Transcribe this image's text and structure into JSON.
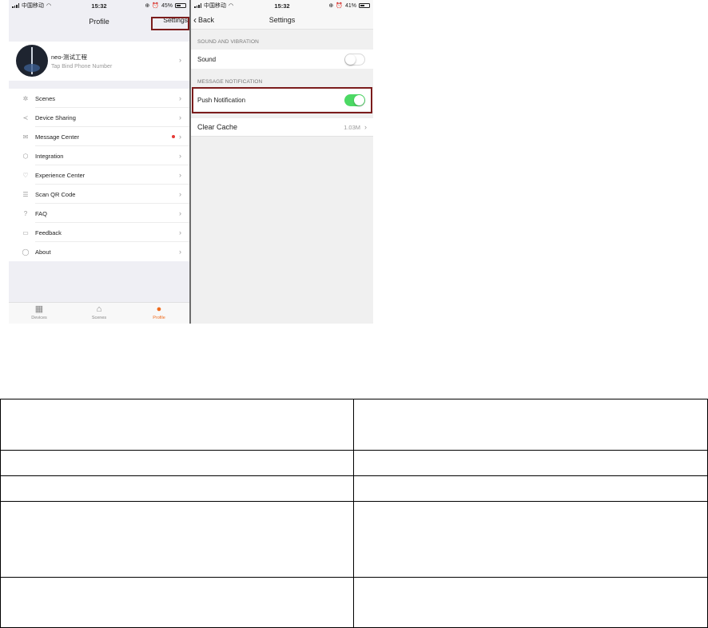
{
  "colors": {
    "accent": "#ef6c1e",
    "toggle_on": "#4cd964",
    "highlight": "#7b1c1c",
    "badge": "#e53935"
  },
  "left_screen": {
    "status": {
      "carrier": "中国移动",
      "time": "15:32",
      "battery": "45%"
    },
    "nav": {
      "title": "Profile",
      "right_action": "Settings"
    },
    "profile": {
      "name": "neo-测试工程",
      "subtitle": "Tap Bind Phone Number"
    },
    "menu": [
      {
        "label": "Scenes",
        "icon": "scenes-icon"
      },
      {
        "label": "Device Sharing",
        "icon": "share-icon"
      },
      {
        "label": "Message Center",
        "icon": "mail-icon",
        "badge": true
      },
      {
        "label": "Integration",
        "icon": "integration-icon"
      },
      {
        "label": "Experience Center",
        "icon": "heart-icon"
      },
      {
        "label": "Scan QR Code",
        "icon": "scan-icon"
      },
      {
        "label": "FAQ",
        "icon": "question-icon"
      },
      {
        "label": "Feedback",
        "icon": "feedback-icon"
      },
      {
        "label": "About",
        "icon": "about-icon"
      }
    ],
    "tabs": [
      {
        "label": "Devices",
        "icon": "grid-icon"
      },
      {
        "label": "Scenes",
        "icon": "home-icon"
      },
      {
        "label": "Profile",
        "icon": "person-icon",
        "active": true
      }
    ]
  },
  "right_screen": {
    "status": {
      "carrier": "中国移动",
      "time": "15:32",
      "battery": "41%"
    },
    "nav": {
      "back_label": "Back",
      "title": "Settings"
    },
    "sections": {
      "sound_header": "SOUND AND VIBRATION",
      "message_header": "MESSAGE NOTIFICATION"
    },
    "rows": {
      "sound": {
        "label": "Sound",
        "toggle_on": false
      },
      "push": {
        "label": "Push Notification",
        "toggle_on": true
      },
      "cache": {
        "label": "Clear Cache",
        "value": "1.03M"
      }
    }
  }
}
